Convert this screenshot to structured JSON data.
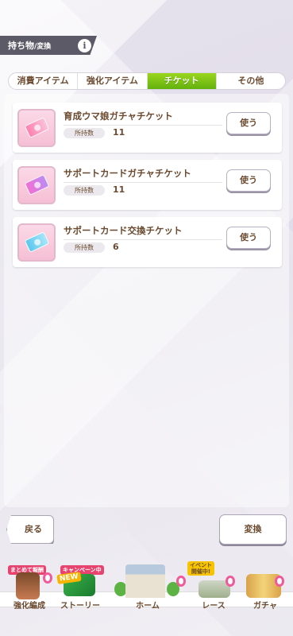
{
  "header": {
    "title": "持ち物",
    "subtitle": "/変換",
    "info_icon": "info-icon"
  },
  "tabs": [
    {
      "label": "消費アイテム",
      "active": false
    },
    {
      "label": "強化アイテム",
      "active": false
    },
    {
      "label": "チケット",
      "active": true
    },
    {
      "label": "その他",
      "active": false
    }
  ],
  "items": [
    {
      "name": "育成ウマ娘ガチャチケット",
      "owned_label": "所持数",
      "count": "11",
      "use_label": "使う",
      "icon": "ticket-pink-icon"
    },
    {
      "name": "サポートカードガチャチケット",
      "owned_label": "所持数",
      "count": "11",
      "use_label": "使う",
      "icon": "ticket-purple-icon"
    },
    {
      "name": "サポートカード交換チケット",
      "owned_label": "所持数",
      "count": "6",
      "use_label": "使う",
      "icon": "ticket-cyan-icon"
    }
  ],
  "footer": {
    "back_label": "戻る",
    "exchange_label": "変換"
  },
  "nav": {
    "items": [
      {
        "label": "強化編成",
        "badge": "まとめて報酬"
      },
      {
        "label": "ストーリー",
        "badge": "キャンペーン中",
        "badge2": "NEW"
      },
      {
        "label": "ホーム"
      },
      {
        "label": "レース",
        "badge": "イベント開催中!"
      },
      {
        "label": "ガチャ"
      }
    ]
  },
  "colors": {
    "accent_green": "#7cc414",
    "text_brown": "#6b4a2f",
    "header_gray": "#5c5a66"
  }
}
